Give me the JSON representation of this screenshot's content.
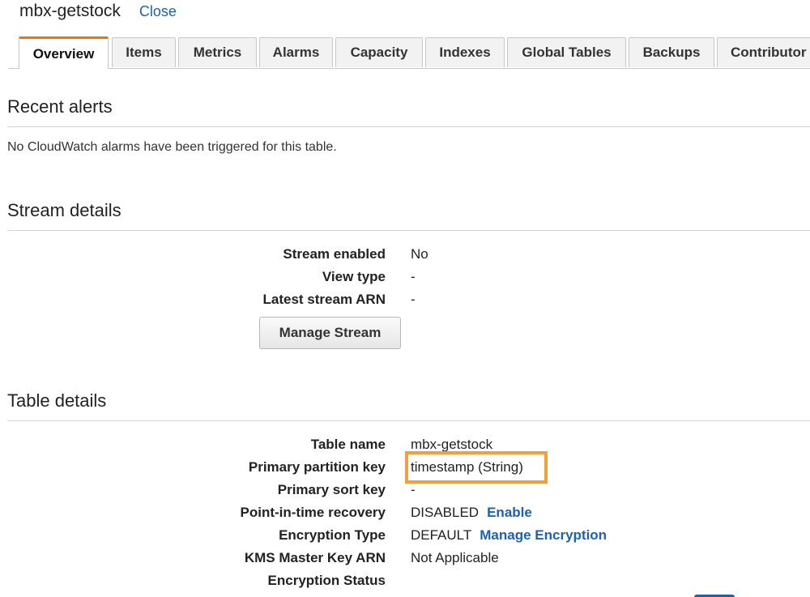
{
  "header": {
    "table_name": "mbx-getstock",
    "close_label": "Close"
  },
  "tabs": [
    {
      "label": "Overview",
      "active": true
    },
    {
      "label": "Items"
    },
    {
      "label": "Metrics"
    },
    {
      "label": "Alarms"
    },
    {
      "label": "Capacity"
    },
    {
      "label": "Indexes"
    },
    {
      "label": "Global Tables"
    },
    {
      "label": "Backups"
    },
    {
      "label": "Contributor"
    }
  ],
  "recent_alerts": {
    "heading": "Recent alerts",
    "message": "No CloudWatch alarms have been triggered for this table."
  },
  "stream_details": {
    "heading": "Stream details",
    "stream_enabled_label": "Stream enabled",
    "stream_enabled_value": "No",
    "view_type_label": "View type",
    "view_type_value": "-",
    "latest_arn_label": "Latest stream ARN",
    "latest_arn_value": "-",
    "manage_stream_label": "Manage Stream"
  },
  "table_details": {
    "heading": "Table details",
    "table_name_label": "Table name",
    "table_name_value": "mbx-getstock",
    "partition_key_label": "Primary partition key",
    "partition_key_value": "timestamp (String)",
    "sort_key_label": "Primary sort key",
    "sort_key_value": "-",
    "pitr_label": "Point-in-time recovery",
    "pitr_value": "DISABLED",
    "pitr_link": "Enable",
    "encryption_type_label": "Encryption Type",
    "encryption_type_value": "DEFAULT",
    "encryption_link": "Manage Encryption",
    "kms_label": "KMS Master Key ARN",
    "kms_value": "Not Applicable",
    "encryption_status_label": "Encryption Status",
    "encryption_status_value": ""
  },
  "colors": {
    "accent_tab": "#ec7211",
    "link": "#1a63b4",
    "highlight": "#f0a13b"
  }
}
